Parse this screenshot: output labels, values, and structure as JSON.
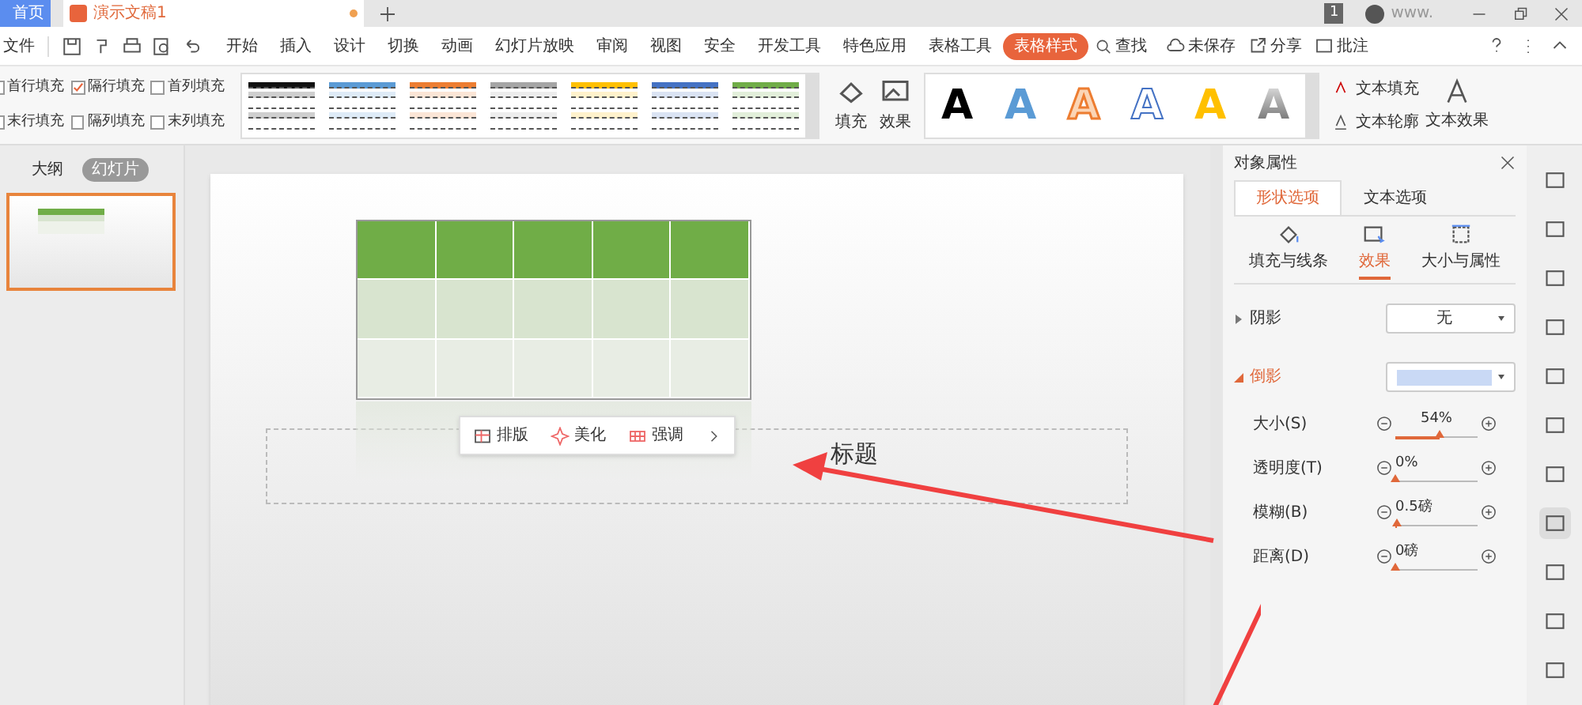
{
  "window": {
    "tabs": [
      {
        "label": "首页",
        "selected": false,
        "kind": "home"
      },
      {
        "label": "演示文稿1",
        "selected": true,
        "kind": "doc"
      }
    ],
    "page_badge": "1",
    "account": "www."
  },
  "menu": {
    "file": "文件",
    "items": [
      {
        "label": "开始",
        "selected": false
      },
      {
        "label": "插入",
        "selected": false
      },
      {
        "label": "设计",
        "selected": false
      },
      {
        "label": "切换",
        "selected": false
      },
      {
        "label": "动画",
        "selected": false
      },
      {
        "label": "幻灯片放映",
        "selected": false
      },
      {
        "label": "审阅",
        "selected": false
      },
      {
        "label": "视图",
        "selected": false
      },
      {
        "label": "安全",
        "selected": false
      },
      {
        "label": "开发工具",
        "selected": false
      },
      {
        "label": "特色应用",
        "selected": false
      },
      {
        "label": "表格工具",
        "selected": false
      },
      {
        "label": "表格样式",
        "selected": true
      }
    ],
    "search": "查找",
    "save_state": "未保存",
    "share": "分享",
    "comment": "批注"
  },
  "ribbon": {
    "options": [
      {
        "label": "首行填充",
        "checked": false
      },
      {
        "label": "隔行填充",
        "checked": true
      },
      {
        "label": "首列填充",
        "checked": false
      },
      {
        "label": "末行填充",
        "checked": false
      },
      {
        "label": "隔列填充",
        "checked": false
      },
      {
        "label": "末列填充",
        "checked": false
      }
    ],
    "table_styles": [
      {
        "color": "#111111"
      },
      {
        "color": "#5b9bd5"
      },
      {
        "color": "#ed7d31"
      },
      {
        "color": "#a5a5a5"
      },
      {
        "color": "#ffc000"
      },
      {
        "color": "#4472c4"
      },
      {
        "color": "#70ad47"
      }
    ],
    "fill": "填充",
    "effect": "效果",
    "wordart": [
      {
        "text": "A",
        "kind": "solid",
        "color": "#000000"
      },
      {
        "text": "A",
        "kind": "solid",
        "color": "#5b9bd5"
      },
      {
        "text": "A",
        "kind": "double"
      },
      {
        "text": "A",
        "kind": "outline"
      },
      {
        "text": "A",
        "kind": "solid",
        "color": "#ffc000"
      },
      {
        "text": "A",
        "kind": "gradient"
      }
    ],
    "text_fill": "文本填充",
    "text_outline": "文本轮廓",
    "text_effect": "文本效果"
  },
  "left_pane": {
    "tabs": [
      {
        "label": "大纲",
        "selected": false
      },
      {
        "label": "幻灯片",
        "selected": true
      }
    ]
  },
  "slide": {
    "subtitle": "标题",
    "toolbar": [
      {
        "label": "排版",
        "kind": "layout"
      },
      {
        "label": "美化",
        "kind": "beautify"
      },
      {
        "label": "强调",
        "kind": "emphasis"
      }
    ]
  },
  "panel": {
    "title": "对象属性",
    "tabs": [
      {
        "label": "形状选项",
        "selected": true
      },
      {
        "label": "文本选项",
        "selected": false
      }
    ],
    "subtabs": [
      {
        "label": "填充与线条",
        "selected": false,
        "kind": "fill"
      },
      {
        "label": "效果",
        "selected": true,
        "kind": "effect"
      },
      {
        "label": "大小与属性",
        "selected": false,
        "kind": "size"
      }
    ],
    "sections": [
      {
        "label": "阴影",
        "expanded": false,
        "value": "无"
      },
      {
        "label": "倒影",
        "expanded": true,
        "color": "#c9d9f5"
      }
    ],
    "sliders": [
      {
        "label": "大小(S)",
        "reading": "54%",
        "level": 0.54
      },
      {
        "label": "透明度(T)",
        "reading": "0%",
        "level": 0
      },
      {
        "label": "模糊(B)",
        "reading": "0.5磅",
        "level": 0.02
      },
      {
        "label": "距离(D)",
        "reading": "0磅",
        "level": 0
      }
    ]
  }
}
